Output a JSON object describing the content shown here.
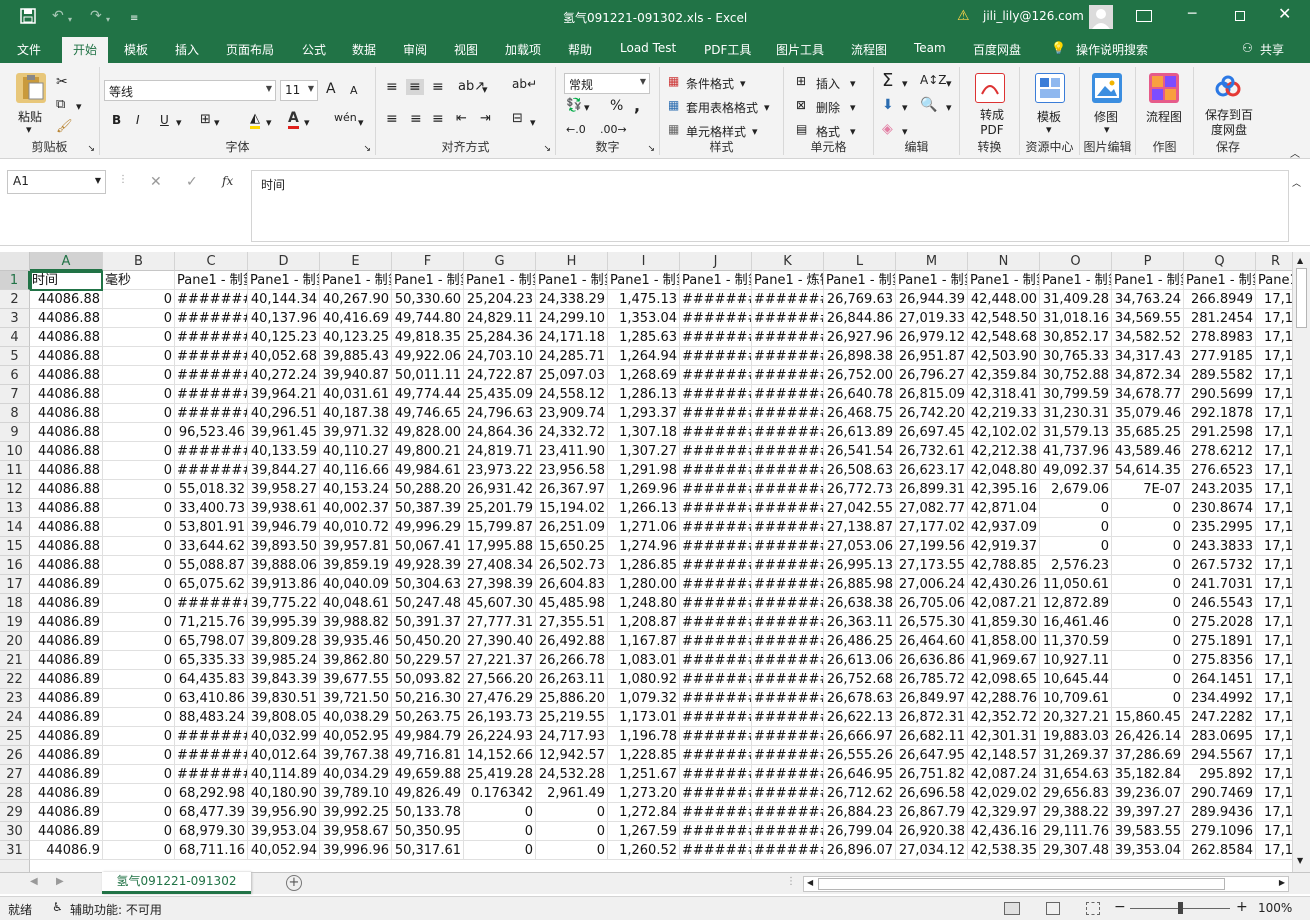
{
  "window": {
    "title": "氢气091221-091302.xls  -  Excel",
    "user": "jili_lily@126.com",
    "accent": "#217346"
  },
  "tabs": [
    "文件",
    "开始",
    "模板",
    "插入",
    "页面布局",
    "公式",
    "数据",
    "审阅",
    "视图",
    "加载项",
    "帮助",
    "Load Test",
    "PDF工具",
    "图片工具",
    "流程图",
    "Team",
    "百度网盘"
  ],
  "active_tab": "开始",
  "search_hint": "操作说明搜索",
  "share": "共享",
  "ribbon": {
    "clipboard": {
      "paste": "粘贴",
      "label": "剪贴板"
    },
    "font": {
      "name": "等线",
      "size": "11",
      "bold": "B",
      "italic": "I",
      "underline": "U",
      "grow": "A",
      "shrink": "A",
      "label": "字体"
    },
    "align": {
      "label": "对齐方式"
    },
    "number": {
      "format": "常规",
      "percent": "%",
      "comma": ",",
      "label": "数字"
    },
    "styles": {
      "conditional": "条件格式",
      "table": "套用表格格式",
      "cell": "单元格样式",
      "label": "样式"
    },
    "cells": {
      "insert": "插入",
      "delete": "删除",
      "format": "格式",
      "label": "单元格"
    },
    "editing": {
      "label": "编辑"
    },
    "convert": {
      "btn": "转成PDF",
      "label": "转换"
    },
    "resource": {
      "btn": "模板",
      "label": "资源中心"
    },
    "imgedit": {
      "btn": "修图",
      "label": "图片编辑"
    },
    "drawing": {
      "btn": "流程图",
      "label": "作图"
    },
    "save": {
      "btn": "保存到百度网盘",
      "label": "保存"
    }
  },
  "formula_bar": {
    "name_box": "A1",
    "fx": "fx",
    "content": "时间"
  },
  "columns": [
    "A",
    "B",
    "C",
    "D",
    "E",
    "F",
    "G",
    "H",
    "I",
    "J",
    "K",
    "L",
    "M",
    "N",
    "O",
    "P",
    "Q",
    "R"
  ],
  "header_row": [
    "时间",
    "毫秒",
    "Pane1 - 制氢",
    "Pane1 - 制氢",
    "Pane1 - 制氢",
    "Pane1 - 制氢",
    "Pane1 - 制氢",
    "Pane1 - 制氢",
    "Pane1 - 制氢",
    "Pane1 - 制氢",
    "Pane1 - 炼钢",
    "Pane1 - 制氢",
    "Pane1 - 制氢",
    "Pane1 - 制氢",
    "Pane1 - 制氢",
    "Pane1 - 制氢",
    "Pane1 - 制氢",
    "Pane1"
  ],
  "rows": [
    [
      "44086.88",
      "0",
      "#######",
      "40,144.34",
      "40,267.90",
      "50,330.60",
      "25,204.23",
      "24,338.29",
      "1,475.13",
      "#######",
      "#######",
      "26,769.63",
      "26,944.39",
      "42,448.00",
      "31,409.28",
      "34,763.24",
      "266.8949",
      "17,1"
    ],
    [
      "44086.88",
      "0",
      "#######",
      "40,137.96",
      "40,416.69",
      "49,744.80",
      "24,829.11",
      "24,299.10",
      "1,353.04",
      "#######",
      "#######",
      "26,844.86",
      "27,019.33",
      "42,548.50",
      "31,018.16",
      "34,569.55",
      "281.2454",
      "17,1"
    ],
    [
      "44086.88",
      "0",
      "#######",
      "40,125.23",
      "40,123.25",
      "49,818.35",
      "25,284.36",
      "24,171.18",
      "1,285.63",
      "#######",
      "#######",
      "26,927.96",
      "26,979.12",
      "42,548.68",
      "30,852.17",
      "34,582.52",
      "278.8983",
      "17,1"
    ],
    [
      "44086.88",
      "0",
      "#######",
      "40,052.68",
      "39,885.43",
      "49,922.06",
      "24,703.10",
      "24,285.71",
      "1,264.94",
      "#######",
      "#######",
      "26,898.38",
      "26,951.87",
      "42,503.90",
      "30,765.33",
      "34,317.43",
      "277.9185",
      "17,1"
    ],
    [
      "44086.88",
      "0",
      "#######",
      "40,272.24",
      "39,940.87",
      "50,011.11",
      "24,722.87",
      "25,097.03",
      "1,268.69",
      "#######",
      "#######",
      "26,752.00",
      "26,796.27",
      "42,359.84",
      "30,752.88",
      "34,872.34",
      "289.5582",
      "17,1"
    ],
    [
      "44086.88",
      "0",
      "#######",
      "39,964.21",
      "40,031.61",
      "49,774.44",
      "25,435.09",
      "24,558.12",
      "1,286.13",
      "#######",
      "#######",
      "26,640.78",
      "26,815.09",
      "42,318.41",
      "30,799.59",
      "34,678.77",
      "290.5699",
      "17,1"
    ],
    [
      "44086.88",
      "0",
      "#######",
      "40,296.51",
      "40,187.38",
      "49,746.65",
      "24,796.63",
      "23,909.74",
      "1,293.37",
      "#######",
      "#######",
      "26,468.75",
      "26,742.20",
      "42,219.33",
      "31,230.31",
      "35,079.46",
      "292.1878",
      "17,1"
    ],
    [
      "44086.88",
      "0",
      "96,523.46",
      "39,961.45",
      "39,971.32",
      "49,828.00",
      "24,864.36",
      "24,332.72",
      "1,307.18",
      "#######",
      "#######",
      "26,613.89",
      "26,697.45",
      "42,102.02",
      "31,579.13",
      "35,685.25",
      "291.2598",
      "17,1"
    ],
    [
      "44086.88",
      "0",
      "#######",
      "40,133.59",
      "40,110.27",
      "49,800.21",
      "24,819.71",
      "23,411.90",
      "1,307.27",
      "#######",
      "#######",
      "26,541.54",
      "26,732.61",
      "42,212.38",
      "41,737.96",
      "43,589.46",
      "278.6212",
      "17,1"
    ],
    [
      "44086.88",
      "0",
      "#######",
      "39,844.27",
      "40,116.66",
      "49,984.61",
      "23,973.22",
      "23,956.58",
      "1,291.98",
      "#######",
      "#######",
      "26,508.63",
      "26,623.17",
      "42,048.80",
      "49,092.37",
      "54,614.35",
      "276.6523",
      "17,1"
    ],
    [
      "44086.88",
      "0",
      "55,018.32",
      "39,958.27",
      "40,153.24",
      "50,288.20",
      "26,931.42",
      "26,367.97",
      "1,269.96",
      "#######",
      "#######",
      "26,772.73",
      "26,899.31",
      "42,395.16",
      "2,679.06",
      "7E-07",
      "243.2035",
      "17,1"
    ],
    [
      "44086.88",
      "0",
      "33,400.73",
      "39,938.61",
      "40,002.37",
      "50,387.39",
      "25,201.79",
      "15,194.02",
      "1,266.13",
      "#######",
      "#######",
      "27,042.55",
      "27,082.77",
      "42,871.04",
      "0",
      "0",
      "230.8674",
      "17,1"
    ],
    [
      "44086.88",
      "0",
      "53,801.91",
      "39,946.79",
      "40,010.72",
      "49,996.29",
      "15,799.87",
      "26,251.09",
      "1,271.06",
      "#######",
      "#######",
      "27,138.87",
      "27,177.02",
      "42,937.09",
      "0",
      "0",
      "235.2995",
      "17,1"
    ],
    [
      "44086.88",
      "0",
      "33,644.62",
      "39,893.50",
      "39,957.81",
      "50,067.41",
      "17,995.88",
      "15,650.25",
      "1,274.96",
      "#######",
      "#######",
      "27,053.06",
      "27,199.56",
      "42,919.37",
      "0",
      "0",
      "243.3833",
      "17,1"
    ],
    [
      "44086.88",
      "0",
      "55,088.87",
      "39,888.06",
      "39,859.19",
      "49,928.39",
      "27,408.34",
      "26,502.73",
      "1,286.85",
      "#######",
      "#######",
      "26,995.13",
      "27,173.55",
      "42,788.85",
      "2,576.23",
      "0",
      "267.5732",
      "17,1"
    ],
    [
      "44086.89",
      "0",
      "65,075.62",
      "39,913.86",
      "40,040.09",
      "50,304.63",
      "27,398.39",
      "26,604.83",
      "1,280.00",
      "#######",
      "#######",
      "26,885.98",
      "27,006.24",
      "42,430.26",
      "11,050.61",
      "0",
      "241.7031",
      "17,1"
    ],
    [
      "44086.89",
      "0",
      "#######",
      "39,775.22",
      "40,048.61",
      "50,247.48",
      "45,607.30",
      "45,485.98",
      "1,248.80",
      "#######",
      "#######",
      "26,638.38",
      "26,705.06",
      "42,087.21",
      "12,872.89",
      "0",
      "246.5543",
      "17,1"
    ],
    [
      "44086.89",
      "0",
      "71,215.76",
      "39,995.39",
      "39,988.82",
      "50,391.37",
      "27,777.31",
      "27,355.51",
      "1,208.87",
      "#######",
      "#######",
      "26,363.11",
      "26,575.30",
      "41,859.30",
      "16,461.46",
      "0",
      "275.2028",
      "17,1"
    ],
    [
      "44086.89",
      "0",
      "65,798.07",
      "39,809.28",
      "39,935.46",
      "50,450.20",
      "27,390.40",
      "26,492.88",
      "1,167.87",
      "#######",
      "#######",
      "26,486.25",
      "26,464.60",
      "41,858.00",
      "11,370.59",
      "0",
      "275.1891",
      "17,1"
    ],
    [
      "44086.89",
      "0",
      "65,335.33",
      "39,985.24",
      "39,862.80",
      "50,229.57",
      "27,221.37",
      "26,266.78",
      "1,083.01",
      "#######",
      "#######",
      "26,613.06",
      "26,636.86",
      "41,969.67",
      "10,927.11",
      "0",
      "275.8356",
      "17,1"
    ],
    [
      "44086.89",
      "0",
      "64,435.83",
      "39,843.39",
      "39,677.55",
      "50,093.82",
      "27,566.20",
      "26,263.11",
      "1,080.92",
      "#######",
      "#######",
      "26,752.68",
      "26,785.72",
      "42,098.65",
      "10,645.44",
      "0",
      "264.1451",
      "17,1"
    ],
    [
      "44086.89",
      "0",
      "63,410.86",
      "39,830.51",
      "39,721.50",
      "50,216.30",
      "27,476.29",
      "25,886.20",
      "1,079.32",
      "#######",
      "#######",
      "26,678.63",
      "26,849.97",
      "42,288.76",
      "10,709.61",
      "0",
      "234.4992",
      "17,1"
    ],
    [
      "44086.89",
      "0",
      "88,483.24",
      "39,808.05",
      "40,038.29",
      "50,263.75",
      "26,193.73",
      "25,219.55",
      "1,173.01",
      "#######",
      "#######",
      "26,622.13",
      "26,872.31",
      "42,352.72",
      "20,327.21",
      "15,860.45",
      "247.2282",
      "17,1"
    ],
    [
      "44086.89",
      "0",
      "#######",
      "40,032.99",
      "40,052.95",
      "49,984.79",
      "26,224.93",
      "24,717.93",
      "1,196.78",
      "#######",
      "#######",
      "26,666.97",
      "26,682.11",
      "42,301.31",
      "19,883.03",
      "26,426.14",
      "283.0695",
      "17,1"
    ],
    [
      "44086.89",
      "0",
      "#######",
      "40,012.64",
      "39,767.38",
      "49,716.81",
      "14,152.66",
      "12,942.57",
      "1,228.85",
      "#######",
      "#######",
      "26,555.26",
      "26,647.95",
      "42,148.57",
      "31,269.37",
      "37,286.69",
      "294.5567",
      "17,1"
    ],
    [
      "44086.89",
      "0",
      "#######",
      "40,114.89",
      "40,034.29",
      "49,659.88",
      "25,419.28",
      "24,532.28",
      "1,251.67",
      "#######",
      "#######",
      "26,646.95",
      "26,751.82",
      "42,087.24",
      "31,654.63",
      "35,182.84",
      "295.892",
      "17,1"
    ],
    [
      "44086.89",
      "0",
      "68,292.98",
      "40,180.90",
      "39,789.10",
      "49,826.49",
      "0.176342",
      "2,961.49",
      "1,273.20",
      "#######",
      "#######",
      "26,712.62",
      "26,696.58",
      "42,029.02",
      "29,656.83",
      "39,236.07",
      "290.7469",
      "17,1"
    ],
    [
      "44086.89",
      "0",
      "68,477.39",
      "39,956.90",
      "39,992.25",
      "50,133.78",
      "0",
      "0",
      "1,272.84",
      "#######",
      "#######",
      "26,884.23",
      "26,867.79",
      "42,329.97",
      "29,388.22",
      "39,397.27",
      "289.9436",
      "17,1"
    ],
    [
      "44086.89",
      "0",
      "68,979.30",
      "39,953.04",
      "39,958.67",
      "50,350.95",
      "0",
      "0",
      "1,267.59",
      "#######",
      "#######",
      "26,799.04",
      "26,920.38",
      "42,436.16",
      "29,111.76",
      "39,583.55",
      "279.1096",
      "17,1"
    ],
    [
      "44086.9",
      "0",
      "68,711.16",
      "40,052.94",
      "39,996.96",
      "50,317.61",
      "0",
      "0",
      "1,260.52",
      "#######",
      "#######",
      "26,896.07",
      "27,034.12",
      "42,538.35",
      "29,307.48",
      "39,353.04",
      "262.8584",
      "17,1"
    ]
  ],
  "sheet_tab": "氢气091221-091302",
  "status": {
    "ready": "就绪",
    "accessibility": "辅助功能: 不可用",
    "zoom": "100%"
  }
}
